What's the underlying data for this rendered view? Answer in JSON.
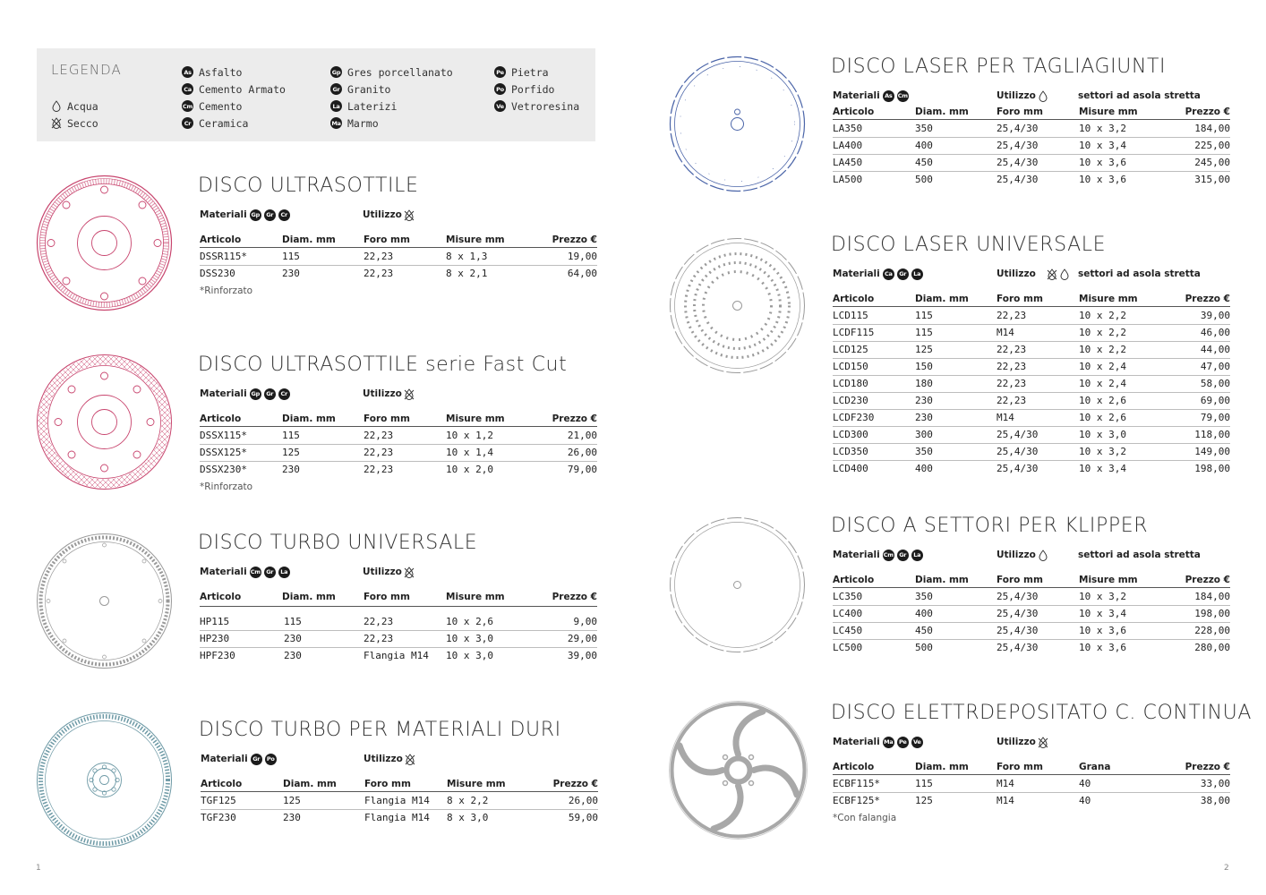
{
  "legend": {
    "title": "LEGENDA",
    "water_label": "Acqua",
    "dry_label": "Secco",
    "materials": [
      {
        "code": "As",
        "label": "Asfalto"
      },
      {
        "code": "Ca",
        "label": "Cemento Armato"
      },
      {
        "code": "Cm",
        "label": "Cemento"
      },
      {
        "code": "Cr",
        "label": "Ceramica"
      },
      {
        "code": "Gp",
        "label": "Gres porcellanato"
      },
      {
        "code": "Gr",
        "label": "Granito"
      },
      {
        "code": "La",
        "label": "Laterizi"
      },
      {
        "code": "Ma",
        "label": "Marmo"
      },
      {
        "code": "Pe",
        "label": "Pietra"
      },
      {
        "code": "Po",
        "label": "Porfido"
      },
      {
        "code": "Ve",
        "label": "Vetroresina"
      }
    ]
  },
  "labels": {
    "materiali": "Materiali",
    "utilizzo": "Utilizzo",
    "settori": "settori ad asola stretta"
  },
  "sections": [
    {
      "title": "DISCO ULTRASOTTILE",
      "materials": [
        "Gp",
        "Gr",
        "Cr"
      ],
      "headers": [
        "Articolo",
        "Diam. mm",
        "Foro mm",
        "Misure mm",
        "Prezzo €"
      ],
      "rows": [
        [
          "DSSR115*",
          "115",
          "22,23",
          "8 x 1,3",
          "19,00"
        ],
        [
          "DSS230",
          "230",
          "22,23",
          "8 x 2,1",
          "64,00"
        ]
      ],
      "footnote": "*Rinforzato"
    },
    {
      "title": "DISCO ULTRASOTTILE serie Fast Cut",
      "materials": [
        "Gp",
        "Gr",
        "Cr"
      ],
      "headers": [
        "Articolo",
        "Diam. mm",
        "Foro mm",
        "Misure mm",
        "Prezzo €"
      ],
      "rows": [
        [
          "DSSX115*",
          "115",
          "22,23",
          "10 x 1,2",
          "21,00"
        ],
        [
          "DSSX125*",
          "125",
          "22,23",
          "10 x 1,4",
          "26,00"
        ],
        [
          "DSSX230*",
          "230",
          "22,23",
          "10 x 2,0",
          "79,00"
        ]
      ],
      "footnote": "*Rinforzato"
    },
    {
      "title": "DISCO TURBO UNIVERSALE",
      "materials": [
        "Cm",
        "Gr",
        "La"
      ],
      "headers": [
        "Articolo",
        "Diam. mm",
        "Foro mm",
        "Misure mm",
        "Prezzo €"
      ],
      "rows": [
        [
          "HP115",
          "115",
          "22,23",
          "10 x 2,6",
          "9,00"
        ],
        [
          "HP230",
          "230",
          "22,23",
          "10 x 3,0",
          "29,00"
        ],
        [
          "HPF230",
          "230",
          "Flangia M14",
          "10 x 3,0",
          "39,00"
        ]
      ]
    },
    {
      "title": "DISCO TURBO PER MATERIALI DURI",
      "materials": [
        "Gr",
        "Po"
      ],
      "headers": [
        "Articolo",
        "Diam. mm",
        "Foro mm",
        "Misure mm",
        "Prezzo €"
      ],
      "rows": [
        [
          "TGF125",
          "125",
          "Flangia M14",
          "8 x 2,2",
          "26,00"
        ],
        [
          "TGF230",
          "230",
          "Flangia M14",
          "8 x 3,0",
          "59,00"
        ]
      ]
    },
    {
      "title": "DISCO LASER PER TAGLIAGIUNTI",
      "materials": [
        "As",
        "Cm"
      ],
      "headers": [
        "Articolo",
        "Diam. mm",
        "Foro mm",
        "Misure mm",
        "Prezzo €"
      ],
      "rows": [
        [
          "LA350",
          "350",
          "25,4/30",
          "10 x 3,2",
          "184,00"
        ],
        [
          "LA400",
          "400",
          "25,4/30",
          "10 x 3,4",
          "225,00"
        ],
        [
          "LA450",
          "450",
          "25,4/30",
          "10 x 3,6",
          "245,00"
        ],
        [
          "LA500",
          "500",
          "25,4/30",
          "10 x 3,6",
          "315,00"
        ]
      ]
    },
    {
      "title": "DISCO LASER UNIVERSALE",
      "materials": [
        "Ca",
        "Gr",
        "La"
      ],
      "headers": [
        "Articolo",
        "Diam. mm",
        "Foro mm",
        "Misure mm",
        "Prezzo €"
      ],
      "rows": [
        [
          "LCD115",
          "115",
          "22,23",
          "10 x 2,2",
          "39,00"
        ],
        [
          "LCDF115",
          "115",
          "M14",
          "10 x 2,2",
          "46,00"
        ],
        [
          "LCD125",
          "125",
          "22,23",
          "10 x 2,2",
          "44,00"
        ],
        [
          "LCD150",
          "150",
          "22,23",
          "10 x 2,4",
          "47,00"
        ],
        [
          "LCD180",
          "180",
          "22,23",
          "10 x 2,4",
          "58,00"
        ],
        [
          "LCD230",
          "230",
          "22,23",
          "10 x 2,6",
          "69,00"
        ],
        [
          "LCDF230",
          "230",
          "M14",
          "10 x 2,6",
          "79,00"
        ],
        [
          "LCD300",
          "300",
          "25,4/30",
          "10 x 3,0",
          "118,00"
        ],
        [
          "LCD350",
          "350",
          "25,4/30",
          "10 x 3,2",
          "149,00"
        ],
        [
          "LCD400",
          "400",
          "25,4/30",
          "10 x 3,4",
          "198,00"
        ]
      ]
    },
    {
      "title": "DISCO A SETTORI PER KLIPPER",
      "materials": [
        "Cm",
        "Gr",
        "La"
      ],
      "headers": [
        "Articolo",
        "Diam. mm",
        "Foro mm",
        "Misure mm",
        "Prezzo €"
      ],
      "rows": [
        [
          "LC350",
          "350",
          "25,4/30",
          "10 x 3,2",
          "184,00"
        ],
        [
          "LC400",
          "400",
          "25,4/30",
          "10 x 3,4",
          "198,00"
        ],
        [
          "LC450",
          "450",
          "25,4/30",
          "10 x 3,6",
          "228,00"
        ],
        [
          "LC500",
          "500",
          "25,4/30",
          "10 x 3,6",
          "280,00"
        ]
      ]
    },
    {
      "title": "DISCO ELETTRDEPOSITATO C. CONTINUA",
      "materials": [
        "Ma",
        "Pe",
        "Ve"
      ],
      "headers": [
        "Articolo",
        "Diam. mm",
        "Foro mm",
        "Grana",
        "Prezzo €"
      ],
      "rows": [
        [
          "ECBF115*",
          "115",
          "M14",
          "40",
          "33,00"
        ],
        [
          "ECBF125*",
          "125",
          "M14",
          "40",
          "38,00"
        ]
      ],
      "footnote": "*Con falangia"
    }
  ],
  "page_numbers": {
    "left": "1",
    "right": "2"
  },
  "colors": {
    "disc_pink": "#c8456e",
    "disc_blue": "#4a64a8",
    "disc_gray": "#9a9a9a",
    "disc_teal": "#6e9aa6",
    "legend_bg": "#ececec"
  }
}
